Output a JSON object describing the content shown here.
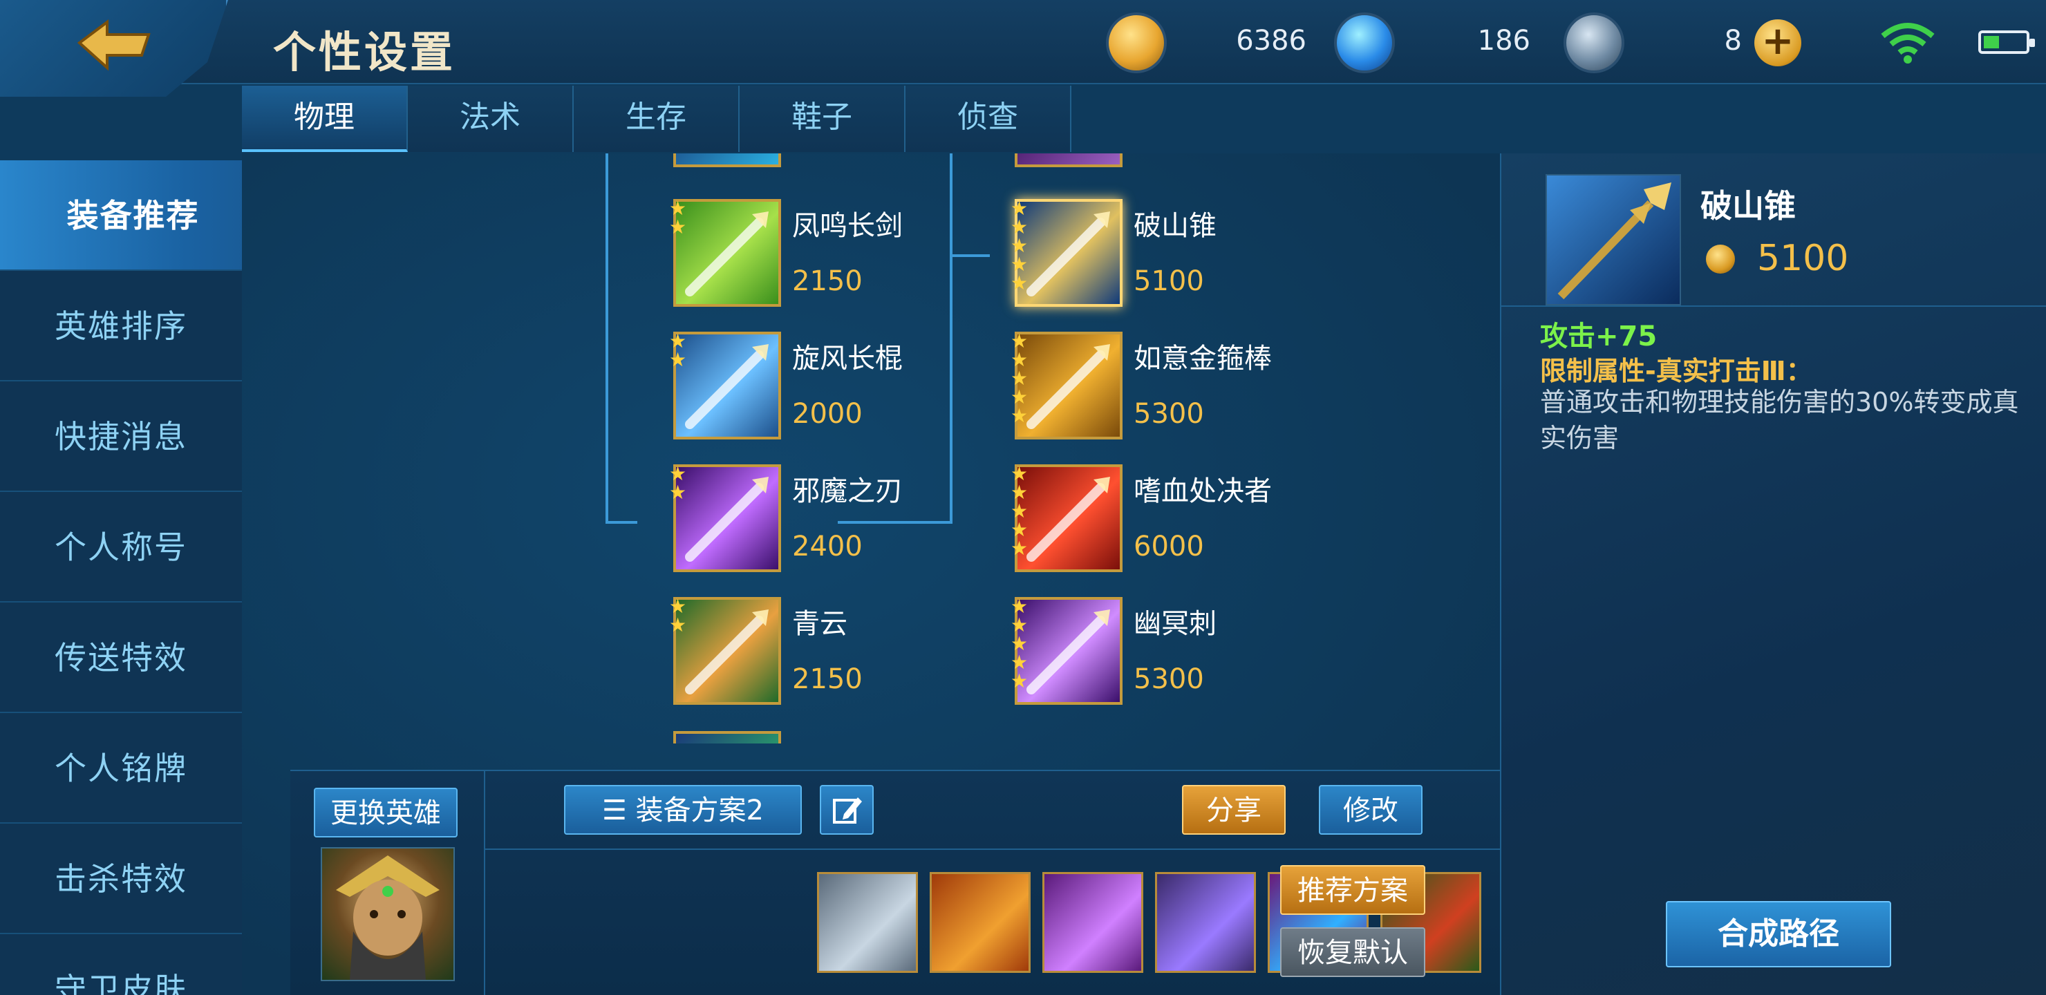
{
  "header": {
    "title": "个性设置",
    "currencies": [
      {
        "name": "gold-coin",
        "value": "6386"
      },
      {
        "name": "diamond",
        "value": "186"
      },
      {
        "name": "ticket",
        "value": "8"
      }
    ]
  },
  "tabs": [
    {
      "label": "物理",
      "active": true
    },
    {
      "label": "法术",
      "active": false
    },
    {
      "label": "生存",
      "active": false
    },
    {
      "label": "鞋子",
      "active": false
    },
    {
      "label": "侦查",
      "active": false
    }
  ],
  "sidebar": [
    {
      "label": "装备推荐",
      "active": true
    },
    {
      "label": "英雄排序"
    },
    {
      "label": "快捷消息"
    },
    {
      "label": "个人称号"
    },
    {
      "label": "传送特效"
    },
    {
      "label": "个人铭牌"
    },
    {
      "label": "击杀特效"
    },
    {
      "label": "守卫皮肤"
    }
  ],
  "tree": {
    "left_column": [
      {
        "name": "凤鸣长剑",
        "price": "2150",
        "stars": 2,
        "colors": [
          "#3a8f1c",
          "#a6e04a"
        ]
      },
      {
        "name": "旋风长棍",
        "price": "2000",
        "stars": 2,
        "colors": [
          "#1c4f8a",
          "#6cc0ff"
        ]
      },
      {
        "name": "邪魔之刃",
        "price": "2400",
        "stars": 2,
        "colors": [
          "#3a0f6a",
          "#c06cff"
        ]
      },
      {
        "name": "青云",
        "price": "2150",
        "stars": 2,
        "colors": [
          "#1f6a2a",
          "#e8a040"
        ]
      }
    ],
    "right_column": [
      {
        "name": "破山锥",
        "price": "5100",
        "stars": 5,
        "selected": true,
        "colors": [
          "#0f3a7a",
          "#e0c060"
        ]
      },
      {
        "name": "如意金箍棒",
        "price": "5300",
        "stars": 5,
        "colors": [
          "#7a4a0a",
          "#f0b030"
        ]
      },
      {
        "name": "嗜血处决者",
        "price": "6000",
        "stars": 5,
        "colors": [
          "#7a0f0a",
          "#ff5030"
        ]
      },
      {
        "name": "幽冥刺",
        "price": "5300",
        "stars": 5,
        "colors": [
          "#3a0f6a",
          "#d08cff"
        ]
      }
    ]
  },
  "bottom": {
    "change_hero": "更换英雄",
    "scheme": "装备方案2",
    "share": "分享",
    "modify": "修改",
    "recommend": "推荐方案",
    "restore": "恢复默认",
    "slot_colors": [
      [
        "#5a6a7a",
        "#c8d6e2"
      ],
      [
        "#a03a0a",
        "#f0a030"
      ],
      [
        "#5a1a7a",
        "#d080ff"
      ],
      [
        "#3a2a6a",
        "#9a7aff"
      ],
      [
        "#6a1a7a",
        "#30b0ff"
      ],
      [
        "#2a5a1a",
        "#d04020"
      ]
    ]
  },
  "detail": {
    "name": "破山锥",
    "price": "5100",
    "stat": "攻击+75",
    "passive": "限制属性-真实打击Ⅲ：",
    "description": "普通攻击和物理技能伤害的30%转变成真实伤害",
    "synth_button": "合成路径"
  }
}
